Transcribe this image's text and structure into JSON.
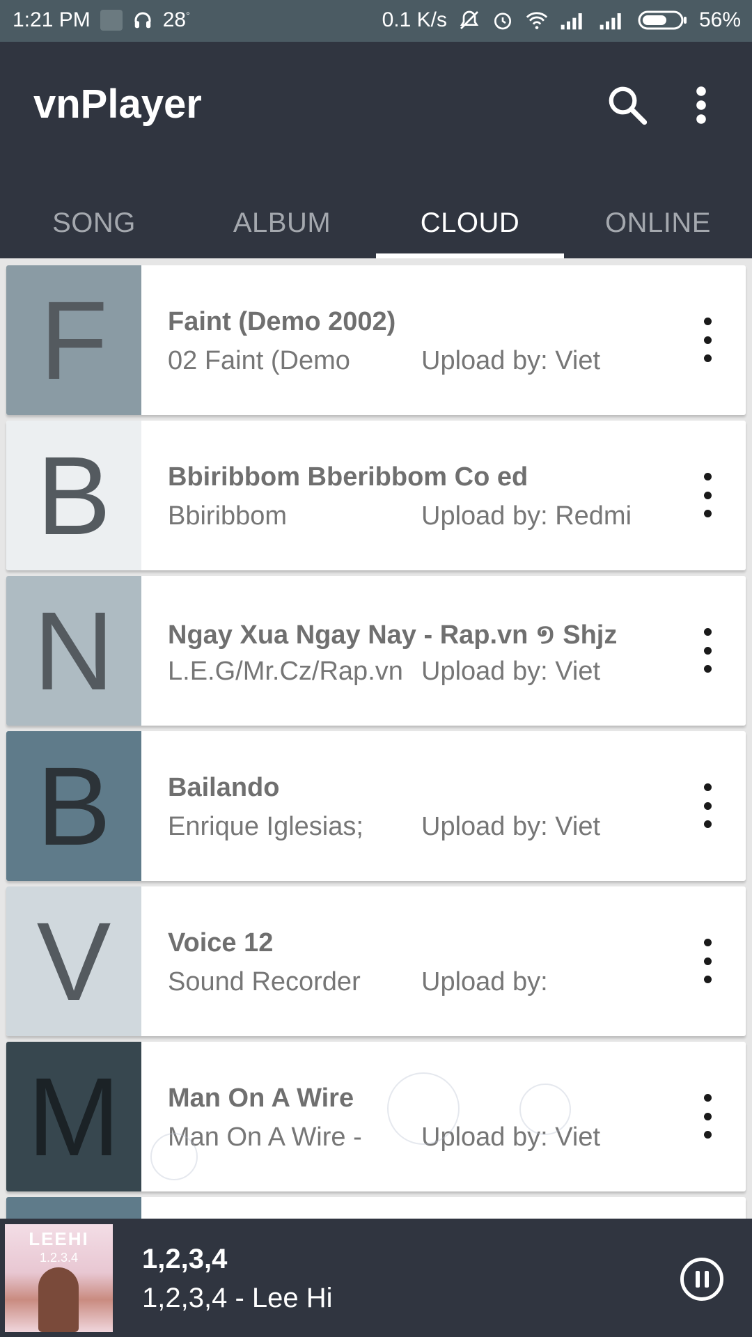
{
  "status_bar": {
    "time": "1:21 PM",
    "temperature": "28",
    "degree": "°",
    "network_speed": "0.1 K/s",
    "battery": "56%"
  },
  "app": {
    "title": "vnPlayer",
    "search_icon": "search-icon",
    "more_icon": "more-vert-icon"
  },
  "tabs": [
    {
      "label": "SONG",
      "active": false
    },
    {
      "label": "ALBUM",
      "active": false
    },
    {
      "label": "CLOUD",
      "active": true
    },
    {
      "label": "ONLINE",
      "active": false
    }
  ],
  "songs": [
    {
      "letter": "F",
      "title": "Faint (Demo 2002)",
      "artist": "02 Faint (Demo",
      "uploader": "Upload by: Viet",
      "color": "#8a9ba4"
    },
    {
      "letter": "B",
      "title": "Bbiribbom Bberibbom Co ed",
      "artist": "Bbiribbom",
      "uploader": "Upload by: Redmi",
      "color": "#eceff1"
    },
    {
      "letter": "N",
      "title": "Ngay Xua Ngay Nay - Rap.vn ១ Shjz",
      "artist": "L.E.G/Mr.Cz/Rap.vn",
      "uploader": "Upload by: Viet",
      "color": "#aebbc2"
    },
    {
      "letter": "B",
      "title": "Bailando",
      "artist": "Enrique Iglesias;",
      "uploader": "Upload by: Viet",
      "color": "#5f7b8a"
    },
    {
      "letter": "V",
      "title": "Voice 12",
      "artist": "Sound Recorder",
      "uploader": "Upload by:",
      "color": "#d0d8dd"
    },
    {
      "letter": "M",
      "title": "Man On A Wire",
      "artist": "Man On A Wire -",
      "uploader": "Upload by: Viet",
      "color": "#37474f"
    }
  ],
  "now_playing": {
    "title": "1,2,3,4",
    "subtitle": "1,2,3,4 - Lee Hi",
    "cover_text": "LEEHI",
    "cover_sub": "1.2.3.4",
    "pause_icon": "pause-circle-icon"
  },
  "colors": {
    "status_bar": "#4b5b63",
    "app_bar": "#303540",
    "tab_inactive": "#a4a8ae",
    "tab_active": "#ffffff"
  }
}
